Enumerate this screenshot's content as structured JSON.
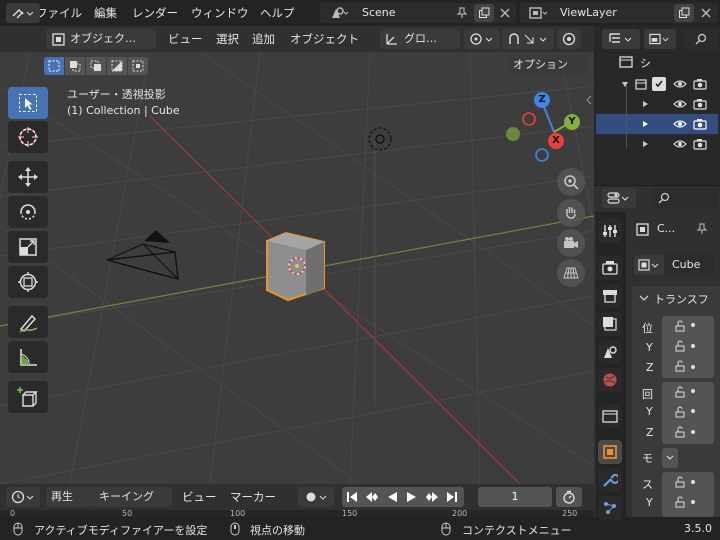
{
  "menubar": {
    "items": [
      "ファイル",
      "編集",
      "レンダー",
      "ウィンドウ",
      "ヘルプ"
    ],
    "scene": "Scene",
    "view_layer": "ViewLayer"
  },
  "viewport_header": {
    "mode": "オブジェク…",
    "menus": [
      "ビュー",
      "選択",
      "追加",
      "オブジェクト"
    ],
    "transform_orientation": "グロ…",
    "options": "オプション"
  },
  "viewport": {
    "view_name": "ユーザー・透視投影",
    "context": "(1) Collection | Cube",
    "gizmo_axes": [
      "Z",
      "Y",
      "X"
    ]
  },
  "timeline": {
    "playback": "再生",
    "keying": "キーイング",
    "view": "ビュー",
    "marker": "マーカー",
    "frame": "1",
    "ruler": [
      "0",
      "50",
      "100",
      "150",
      "200",
      "250"
    ]
  },
  "status": {
    "left": "アクティブモディファイアーを設定",
    "mid": "視点の移動",
    "right": "コンテクストメニュー",
    "version": "3.5.0"
  },
  "outliner": {
    "root": "シ"
  },
  "properties": {
    "object_short": "C...",
    "object_name": "Cube",
    "panel": "トランスフ",
    "rows": [
      "位",
      "Y",
      "Z",
      "回",
      "Y",
      "Z",
      "モ",
      "ス",
      "Y"
    ]
  },
  "colors": {
    "accent": "#4772b3",
    "select_orange": "#f0922a",
    "axis_x": "#e4423f",
    "axis_y": "#84b13a",
    "axis_z": "#3d86e2"
  }
}
